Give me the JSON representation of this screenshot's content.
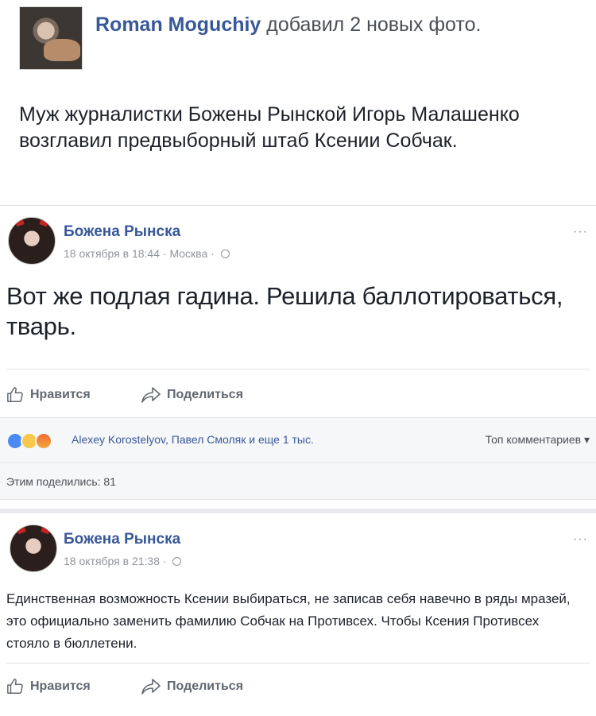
{
  "top_post": {
    "author": "Roman Moguchiy",
    "action": "добавил 2 новых фото.",
    "text": "Муж журналистки Божены Рынской Игорь Малашенко возглавил предвыборный штаб Ксении Собчак."
  },
  "post1": {
    "author": "Божена Рынска",
    "meta": "18 октября в 18:44 · Москва ·",
    "more": "···",
    "text": "Вот же подлая гадина. Решила баллотироваться, тварь.",
    "like_label": "Нравится",
    "share_label": "Поделиться",
    "reactions": [
      "like-icon",
      "haha-icon",
      "angry-icon"
    ],
    "reactors": "Alexey Korostelyov, Павел Смоляк и еще 1 тыс.",
    "top_comments": "Топ комментариев ▾",
    "shares": "Этим поделились: 81"
  },
  "post2": {
    "author": "Божена Рынска",
    "meta": "18 октября в 21:38 ·",
    "more": "···",
    "text": "Единственная возможность Ксении выбираться, не записав себя навечно в ряды мразей, это официально заменить фамилию Собчак на Противсех. Чтобы Ксения Противсех стояло в бюллетени.",
    "like_label": "Нравится",
    "share_label": "Поделиться"
  },
  "colors": {
    "link": "#385898",
    "meta": "#90949c",
    "action": "#616770",
    "bar_bg": "#f6f7f9"
  }
}
